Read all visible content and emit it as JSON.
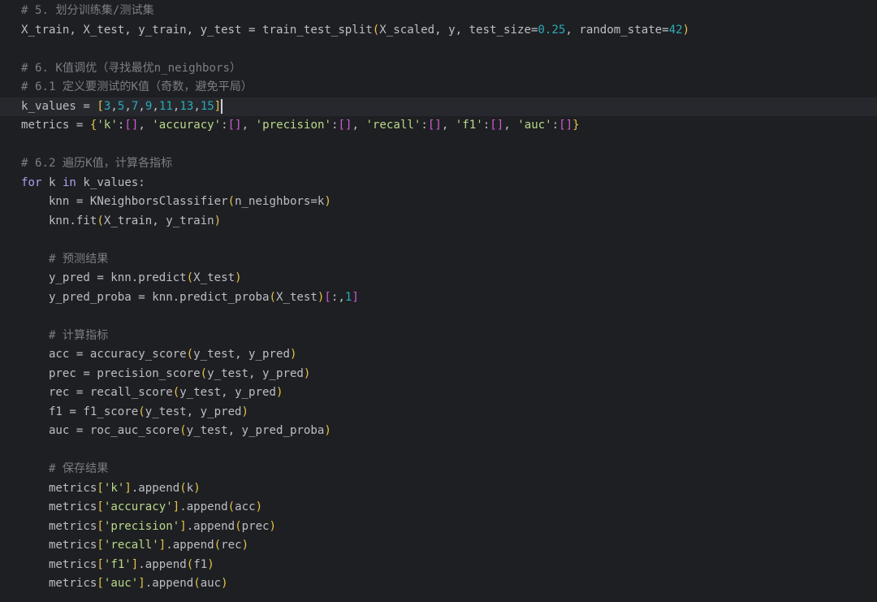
{
  "colors": {
    "background": "#1e1f22",
    "current_line": "#26282e",
    "comment": "#7a7e85",
    "keyword": "#a9a1f0",
    "number": "#2aacb8",
    "string": "#b9d98a",
    "bracket": "#e3c44b",
    "bracket_nested": "#d05bd6",
    "text": "#bcbec4"
  },
  "editor": {
    "current_line_index": 5,
    "lines": [
      {
        "tokens": [
          {
            "t": "comment",
            "v": "# 5. 划分训练集/测试集"
          }
        ]
      },
      {
        "tokens": [
          {
            "t": "plain",
            "v": "X_train, X_test, y_train, y_test = train_test_split"
          },
          {
            "t": "brace",
            "v": "("
          },
          {
            "t": "plain",
            "v": "X_scaled, y, test_size="
          },
          {
            "t": "number",
            "v": "0.25"
          },
          {
            "t": "plain",
            "v": ", random_state="
          },
          {
            "t": "number",
            "v": "42"
          },
          {
            "t": "brace",
            "v": ")"
          }
        ]
      },
      {
        "tokens": []
      },
      {
        "tokens": [
          {
            "t": "comment",
            "v": "# 6. K值调优（寻找最优n_neighbors）"
          }
        ]
      },
      {
        "tokens": [
          {
            "t": "comment",
            "v": "# 6.1 定义要测试的K值（奇数，避免平局）"
          }
        ]
      },
      {
        "tokens": [
          {
            "t": "plain",
            "v": "k_values = "
          },
          {
            "t": "brace",
            "v": "["
          },
          {
            "t": "number",
            "v": "3"
          },
          {
            "t": "plain",
            "v": ","
          },
          {
            "t": "number",
            "v": "5"
          },
          {
            "t": "plain",
            "v": ","
          },
          {
            "t": "number",
            "v": "7"
          },
          {
            "t": "plain",
            "v": ","
          },
          {
            "t": "number",
            "v": "9"
          },
          {
            "t": "plain",
            "v": ","
          },
          {
            "t": "number",
            "v": "11"
          },
          {
            "t": "plain",
            "v": ","
          },
          {
            "t": "number",
            "v": "13"
          },
          {
            "t": "plain",
            "v": ","
          },
          {
            "t": "number",
            "v": "15"
          },
          {
            "t": "brace",
            "v": "]"
          },
          {
            "t": "caret",
            "v": ""
          }
        ]
      },
      {
        "tokens": [
          {
            "t": "plain",
            "v": "metrics = "
          },
          {
            "t": "brace",
            "v": "{"
          },
          {
            "t": "string",
            "v": "'k'"
          },
          {
            "t": "plain",
            "v": ":"
          },
          {
            "t": "brace2",
            "v": "[]"
          },
          {
            "t": "plain",
            "v": ", "
          },
          {
            "t": "string",
            "v": "'accuracy'"
          },
          {
            "t": "plain",
            "v": ":"
          },
          {
            "t": "brace2",
            "v": "[]"
          },
          {
            "t": "plain",
            "v": ", "
          },
          {
            "t": "string",
            "v": "'precision'"
          },
          {
            "t": "plain",
            "v": ":"
          },
          {
            "t": "brace2",
            "v": "[]"
          },
          {
            "t": "plain",
            "v": ", "
          },
          {
            "t": "string",
            "v": "'recall'"
          },
          {
            "t": "plain",
            "v": ":"
          },
          {
            "t": "brace2",
            "v": "[]"
          },
          {
            "t": "plain",
            "v": ", "
          },
          {
            "t": "string",
            "v": "'f1'"
          },
          {
            "t": "plain",
            "v": ":"
          },
          {
            "t": "brace2",
            "v": "[]"
          },
          {
            "t": "plain",
            "v": ", "
          },
          {
            "t": "string",
            "v": "'auc'"
          },
          {
            "t": "plain",
            "v": ":"
          },
          {
            "t": "brace2",
            "v": "[]"
          },
          {
            "t": "brace",
            "v": "}"
          }
        ]
      },
      {
        "tokens": []
      },
      {
        "tokens": [
          {
            "t": "comment",
            "v": "# 6.2 遍历K值，计算各指标"
          }
        ]
      },
      {
        "tokens": [
          {
            "t": "kw2",
            "v": "for"
          },
          {
            "t": "plain",
            "v": " k "
          },
          {
            "t": "kw2",
            "v": "in"
          },
          {
            "t": "plain",
            "v": " k_values:"
          }
        ]
      },
      {
        "tokens": [
          {
            "t": "plain",
            "v": "    knn = KNeighborsClassifier"
          },
          {
            "t": "brace",
            "v": "("
          },
          {
            "t": "plain",
            "v": "n_neighbors=k"
          },
          {
            "t": "brace",
            "v": ")"
          }
        ]
      },
      {
        "tokens": [
          {
            "t": "plain",
            "v": "    knn.fit"
          },
          {
            "t": "brace",
            "v": "("
          },
          {
            "t": "plain",
            "v": "X_train, y_train"
          },
          {
            "t": "brace",
            "v": ")"
          }
        ]
      },
      {
        "tokens": []
      },
      {
        "tokens": [
          {
            "t": "comment",
            "v": "    # 预测结果"
          }
        ]
      },
      {
        "tokens": [
          {
            "t": "plain",
            "v": "    y_pred = knn.predict"
          },
          {
            "t": "brace",
            "v": "("
          },
          {
            "t": "plain",
            "v": "X_test"
          },
          {
            "t": "brace",
            "v": ")"
          }
        ]
      },
      {
        "tokens": [
          {
            "t": "plain",
            "v": "    y_pred_proba = knn.predict_proba"
          },
          {
            "t": "brace",
            "v": "("
          },
          {
            "t": "plain",
            "v": "X_test"
          },
          {
            "t": "brace",
            "v": ")"
          },
          {
            "t": "brace2",
            "v": "["
          },
          {
            "t": "plain",
            "v": ":,"
          },
          {
            "t": "number",
            "v": "1"
          },
          {
            "t": "brace2",
            "v": "]"
          }
        ]
      },
      {
        "tokens": []
      },
      {
        "tokens": [
          {
            "t": "comment",
            "v": "    # 计算指标"
          }
        ]
      },
      {
        "tokens": [
          {
            "t": "plain",
            "v": "    acc = accuracy_score"
          },
          {
            "t": "brace",
            "v": "("
          },
          {
            "t": "plain",
            "v": "y_test, y_pred"
          },
          {
            "t": "brace",
            "v": ")"
          }
        ]
      },
      {
        "tokens": [
          {
            "t": "plain",
            "v": "    prec = precision_score"
          },
          {
            "t": "brace",
            "v": "("
          },
          {
            "t": "plain",
            "v": "y_test, y_pred"
          },
          {
            "t": "brace",
            "v": ")"
          }
        ]
      },
      {
        "tokens": [
          {
            "t": "plain",
            "v": "    rec = recall_score"
          },
          {
            "t": "brace",
            "v": "("
          },
          {
            "t": "plain",
            "v": "y_test, y_pred"
          },
          {
            "t": "brace",
            "v": ")"
          }
        ]
      },
      {
        "tokens": [
          {
            "t": "plain",
            "v": "    f1 = f1_score"
          },
          {
            "t": "brace",
            "v": "("
          },
          {
            "t": "plain",
            "v": "y_test, y_pred"
          },
          {
            "t": "brace",
            "v": ")"
          }
        ]
      },
      {
        "tokens": [
          {
            "t": "plain",
            "v": "    auc = roc_auc_score"
          },
          {
            "t": "brace",
            "v": "("
          },
          {
            "t": "plain",
            "v": "y_test, y_pred_proba"
          },
          {
            "t": "brace",
            "v": ")"
          }
        ]
      },
      {
        "tokens": []
      },
      {
        "tokens": [
          {
            "t": "comment",
            "v": "    # 保存结果"
          }
        ]
      },
      {
        "tokens": [
          {
            "t": "plain",
            "v": "    metrics"
          },
          {
            "t": "brace",
            "v": "["
          },
          {
            "t": "string",
            "v": "'k'"
          },
          {
            "t": "brace",
            "v": "]"
          },
          {
            "t": "plain",
            "v": ".append"
          },
          {
            "t": "brace",
            "v": "("
          },
          {
            "t": "plain",
            "v": "k"
          },
          {
            "t": "brace",
            "v": ")"
          }
        ]
      },
      {
        "tokens": [
          {
            "t": "plain",
            "v": "    metrics"
          },
          {
            "t": "brace",
            "v": "["
          },
          {
            "t": "string",
            "v": "'accuracy'"
          },
          {
            "t": "brace",
            "v": "]"
          },
          {
            "t": "plain",
            "v": ".append"
          },
          {
            "t": "brace",
            "v": "("
          },
          {
            "t": "plain",
            "v": "acc"
          },
          {
            "t": "brace",
            "v": ")"
          }
        ]
      },
      {
        "tokens": [
          {
            "t": "plain",
            "v": "    metrics"
          },
          {
            "t": "brace",
            "v": "["
          },
          {
            "t": "string",
            "v": "'precision'"
          },
          {
            "t": "brace",
            "v": "]"
          },
          {
            "t": "plain",
            "v": ".append"
          },
          {
            "t": "brace",
            "v": "("
          },
          {
            "t": "plain",
            "v": "prec"
          },
          {
            "t": "brace",
            "v": ")"
          }
        ]
      },
      {
        "tokens": [
          {
            "t": "plain",
            "v": "    metrics"
          },
          {
            "t": "brace",
            "v": "["
          },
          {
            "t": "string",
            "v": "'recall'"
          },
          {
            "t": "brace",
            "v": "]"
          },
          {
            "t": "plain",
            "v": ".append"
          },
          {
            "t": "brace",
            "v": "("
          },
          {
            "t": "plain",
            "v": "rec"
          },
          {
            "t": "brace",
            "v": ")"
          }
        ]
      },
      {
        "tokens": [
          {
            "t": "plain",
            "v": "    metrics"
          },
          {
            "t": "brace",
            "v": "["
          },
          {
            "t": "string",
            "v": "'f1'"
          },
          {
            "t": "brace",
            "v": "]"
          },
          {
            "t": "plain",
            "v": ".append"
          },
          {
            "t": "brace",
            "v": "("
          },
          {
            "t": "plain",
            "v": "f1"
          },
          {
            "t": "brace",
            "v": ")"
          }
        ]
      },
      {
        "tokens": [
          {
            "t": "plain",
            "v": "    metrics"
          },
          {
            "t": "brace",
            "v": "["
          },
          {
            "t": "string",
            "v": "'auc'"
          },
          {
            "t": "brace",
            "v": "]"
          },
          {
            "t": "plain",
            "v": ".append"
          },
          {
            "t": "brace",
            "v": "("
          },
          {
            "t": "plain",
            "v": "auc"
          },
          {
            "t": "brace",
            "v": ")"
          }
        ]
      }
    ]
  }
}
